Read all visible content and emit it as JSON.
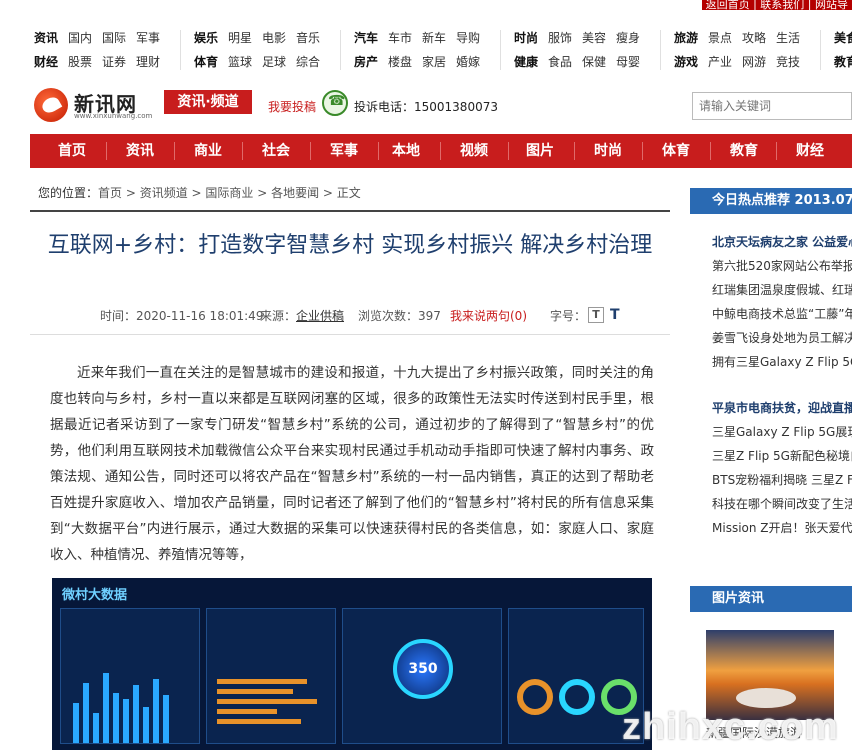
{
  "topbar": {
    "text": "返回首页 | 联系我们 | 网站导"
  },
  "catnav": {
    "groups": [
      {
        "row1": [
          "资讯",
          "国内",
          "国际",
          "军事"
        ],
        "row2": [
          "财经",
          "股票",
          "证券",
          "理财"
        ]
      },
      {
        "row1": [
          "娱乐",
          "明星",
          "电影",
          "音乐"
        ],
        "row2": [
          "体育",
          "篮球",
          "足球",
          "综合"
        ]
      },
      {
        "row1": [
          "汽车",
          "车市",
          "新车",
          "导购"
        ],
        "row2": [
          "房产",
          "楼盘",
          "家居",
          "婚嫁"
        ]
      },
      {
        "row1": [
          "时尚",
          "服饰",
          "美容",
          "瘦身"
        ],
        "row2": [
          "健康",
          "食品",
          "保健",
          "母婴"
        ]
      },
      {
        "row1": [
          "旅游",
          "景点",
          "攻略",
          "生活"
        ],
        "row2": [
          "游戏",
          "产业",
          "网游",
          "竞技"
        ]
      },
      {
        "row1": [
          "美食"
        ],
        "row2": [
          "教育"
        ]
      }
    ]
  },
  "header": {
    "logo_name": "新讯网",
    "logo_url": "www.xinxunwang.com",
    "channel": "资讯·频道",
    "contribute": "我要投稿",
    "hotline": "投诉电话：15001380073",
    "search_placeholder": "请输入关键词"
  },
  "mainnav": [
    "首页",
    "资讯",
    "商业",
    "社会",
    "军事",
    "本地",
    "视频",
    "图片",
    "时尚",
    "体育",
    "教育",
    "财经"
  ],
  "breadcrumb": {
    "label": "您的位置：",
    "path": "首页 > 资讯频道 > 国际商业 > 各地要闻 > 正文"
  },
  "article": {
    "title": "互联网+乡村：打造数字智慧乡村 实现乡村振兴 解决乡村治理",
    "time": "时间：2020-11-16 18:01:49",
    "source_label": "来源：",
    "source": "企业供稿",
    "views": "浏览次数：397",
    "comment": "我来说两句(0)",
    "fontsize_label": "字号：",
    "font_small": "T",
    "font_big": "T",
    "paragraph": "近来年我们一直在关注的是智慧城市的建设和报道，十九大提出了乡村振兴政策，同时关注的角度也转向与乡村，乡村一直以来都是互联网闭塞的区域，很多的政策性无法实时传送到村民手里，根据最近记者采访到了一家专门研发“智慧乡村”系统的公司，通过初步的了解得到了“智慧乡村”的优势，他们利用互联网技术加载微信公众平台来实现村民通过手机动动手指即可快速了解村内事务、政策法规、通知公告，同时还可以将农产品在“智慧乡村”系统的一村一品内销售，真正的达到了帮助老百姓提升家庭收入、增加农产品销量，同时记者还了解到了他们的“智慧乡村”将村民的所有信息采集到“大数据平台”内进行展示，通过大数据的采集可以快速获得村民的各类信息，如：家庭人口、家庭收入、种植情况、养殖情况等等，",
    "dashboard_title": "微村大数据",
    "dashboard_gauge": "350"
  },
  "sidebar": {
    "hot_title": "今日热点推荐 2013.07.0",
    "hot_items": [
      {
        "text": "北京天坛病友之家 公益爱心",
        "bold": true
      },
      {
        "text": "第六批520家网站公布举报",
        "bold": false
      },
      {
        "text": "红瑞集团温泉度假城、红瑞",
        "bold": false
      },
      {
        "text": "中鲸电商技术总监“工藤”年",
        "bold": false
      },
      {
        "text": "姜雪飞设身处地为员工解决",
        "bold": false
      },
      {
        "text": "拥有三星Galaxy Z Flip 5G",
        "bold": false
      },
      {
        "text": "平泉市电商扶贫，迎战直播",
        "bold": true
      },
      {
        "text": "三星Galaxy Z Flip 5G展现",
        "bold": false
      },
      {
        "text": "三星Z Flip 5G新配色秘境白",
        "bold": false
      },
      {
        "text": "BTS宠粉福利揭晓 三星Z F",
        "bold": false
      },
      {
        "text": "科技在哪个瞬间改变了生活",
        "bold": false
      },
      {
        "text": "Mission Z开启！张天爱代号",
        "bold": false
      }
    ],
    "photo_title": "图片资讯",
    "photo_caption": "新疆国际沙漠旅游"
  },
  "watermark": "zhihxc.com"
}
